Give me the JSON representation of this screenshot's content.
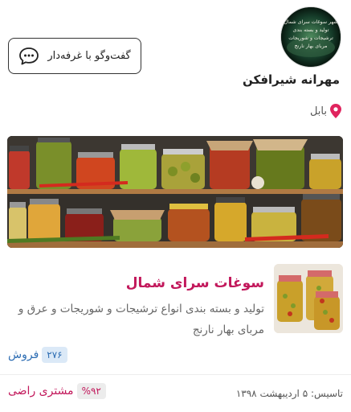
{
  "shop": {
    "name": "مهرانه شیرافکن",
    "location": "بابل",
    "logo_lines": [
      "شهر سوغات سرای شمال",
      "تولید و بسته بندی",
      "ترشیجات و شوریجات",
      "مربای بهار نارنج"
    ]
  },
  "chat": {
    "label": "گفت‌وگو با غرفه‌دار"
  },
  "product": {
    "title": "سوغات سرای شمال",
    "description": "تولید و بسته بندی انواع ترشیجات و شوریجات و عرق و مربای بهار نارنج"
  },
  "stats": {
    "sales_count": "۲۷۶",
    "sales_label": "فروش",
    "satisfaction_value": "%۹۲",
    "satisfaction_label": "مشتری راضی",
    "founded": "تاسیس: ۵ اردیبهشت ۱۳۹۸"
  },
  "colors": {
    "accent": "#c2185b",
    "link": "#2d6db3",
    "location_pin": "#e0245e"
  },
  "icons": {
    "chat": "chat-bubble-icon",
    "location": "location-pin-icon"
  }
}
